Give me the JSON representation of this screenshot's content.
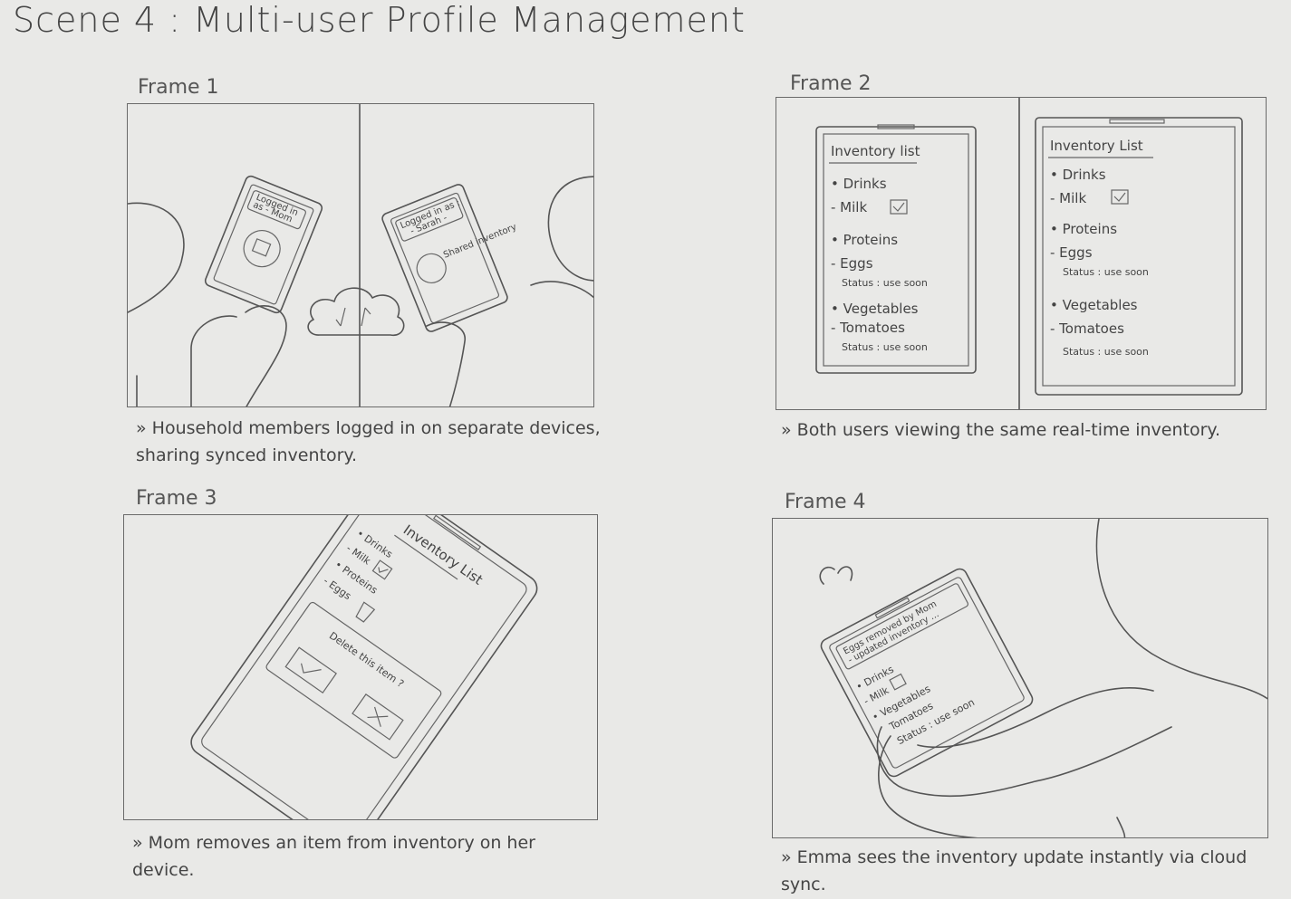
{
  "scene_title": "Scene 4 : Multi-user Profile Management",
  "frames": [
    {
      "label": "Frame 1",
      "caption": "» Household members logged in on separate devices, sharing synced inventory.",
      "left_device": {
        "status_line1": "Logged in",
        "status_line2": "as - Mom"
      },
      "right_device": {
        "status_line1": "Logged in as :",
        "status_line2": "- Sarah -",
        "text": "Shared inventory"
      }
    },
    {
      "label": "Frame 2",
      "caption": "» Both users viewing the same real-time inventory.",
      "list_title": "Inventory list",
      "list_title_right": "Inventory List",
      "items": [
        "• Drinks",
        "- Milk",
        "• Proteins",
        "- Eggs",
        "Status : use soon",
        "• Vegetables",
        "- Tomatoes",
        "Status : use soon"
      ]
    },
    {
      "label": "Frame 3",
      "caption": "» Mom removes an item from inventory on her device.",
      "list_title": "Inventory List",
      "items": [
        "• Drinks",
        "- Milk",
        "• Proteins",
        "- Eggs"
      ],
      "dialog_text": "Delete this item ?"
    },
    {
      "label": "Frame 4",
      "caption": "» Emma sees the inventory update instantly via cloud sync.",
      "notice_line1": "Eggs removed by Mom",
      "notice_line2": "- updated inventory ...",
      "items": [
        "• Drinks",
        "- Milk",
        "• Vegetables",
        "Tomatoes",
        "Status : use soon"
      ]
    }
  ]
}
